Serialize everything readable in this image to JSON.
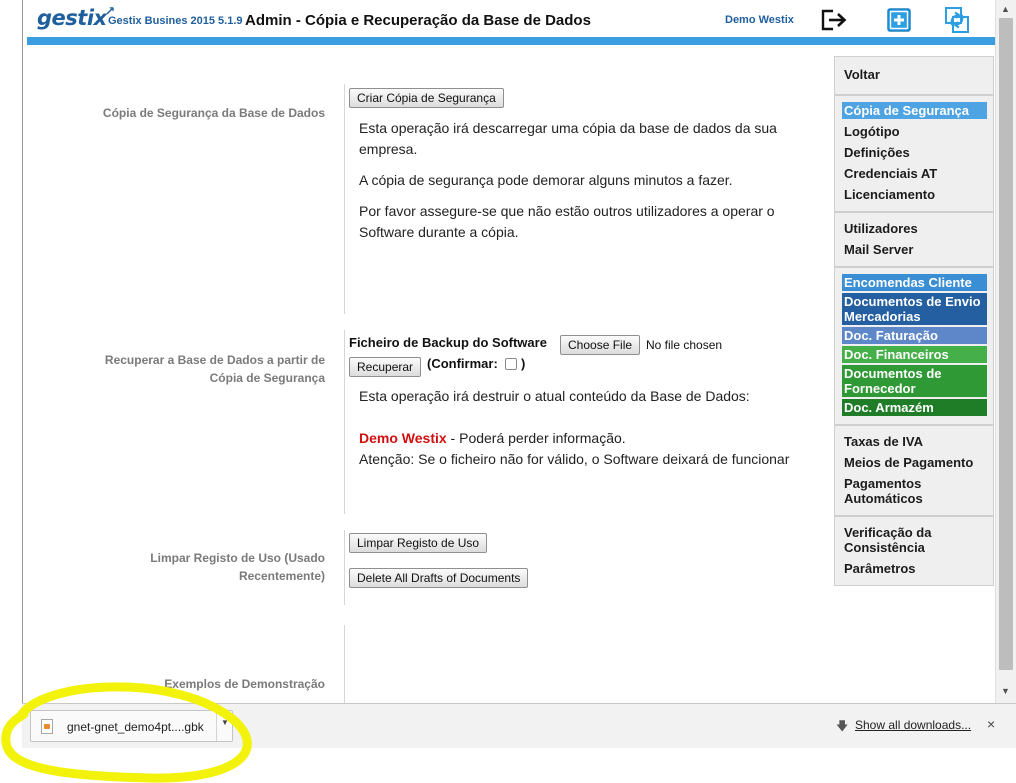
{
  "header": {
    "logo": "gestix",
    "app_version": "Gestix Busines 2015 5.1.9",
    "page_title": "Admin - Cópia e Recuperação da Base de Dados",
    "user_name": "Demo Westix",
    "icons": [
      "logout-icon",
      "add-icon",
      "sync-icon"
    ],
    "accent_color": "#3b9ee0"
  },
  "sections": {
    "backup": {
      "label": "Cópia de Segurança da Base de Dados",
      "button": "Criar Cópia de Segurança",
      "para1": "Esta operação irá descarregar uma cópia da base de dados da sua empresa.",
      "para2": "A cópia de segurança pode demorar alguns minutos a fazer.",
      "para3": "Por favor assegure-se que não estão outros utilizadores a operar o Software durante a cópia."
    },
    "restore": {
      "label": "Recuperar a Base de Dados a partir de Cópia de Segurança",
      "file_label": "Ficheiro de Backup do Software",
      "choose_file": "Choose File",
      "file_status": "No file chosen",
      "button": "Recuperar",
      "confirm_label": "(Confirmar:",
      "confirm_close": ")",
      "warning": "Esta operação irá destruir o atual conteúdo da Base de Dados:",
      "company_name": "Demo Westix",
      "company_warning": " - Poderá perder informação.",
      "attention": "Atenção: Se o ficheiro não for válido, o Software deixará de funcionar"
    },
    "clear_usage": {
      "label": "Limpar Registo de Uso (Usado Recentemente)",
      "button1": "Limpar Registo de Uso",
      "button2": "Delete All Drafts of Documents"
    },
    "demo": {
      "label": "Exemplos de Demonstração"
    }
  },
  "menu": {
    "group1": [
      "Voltar"
    ],
    "group2": [
      "Cópia de Segurança",
      "Logótipo",
      "Definições",
      "Credenciais AT",
      "Licenciamento"
    ],
    "group3": [
      "Utilizadores",
      "Mail Server"
    ],
    "group4": [
      "Encomendas Cliente",
      "Documentos de Envio Mercadorias",
      "Doc. Faturação",
      "Doc. Financeiros",
      "Documentos de Fornecedor",
      "Doc. Armazém"
    ],
    "group5": [
      "Taxas de IVA",
      "Meios de Pagamento",
      "Pagamentos Automáticos"
    ],
    "group6": [
      "Verificação da Consistência",
      "Parâmetros"
    ],
    "active_item": "Cópia de Segurança"
  },
  "downloads": {
    "file_name": "gnet-gnet_demo4pt....gbk",
    "show_all": "Show all downloads...",
    "close": "×"
  }
}
